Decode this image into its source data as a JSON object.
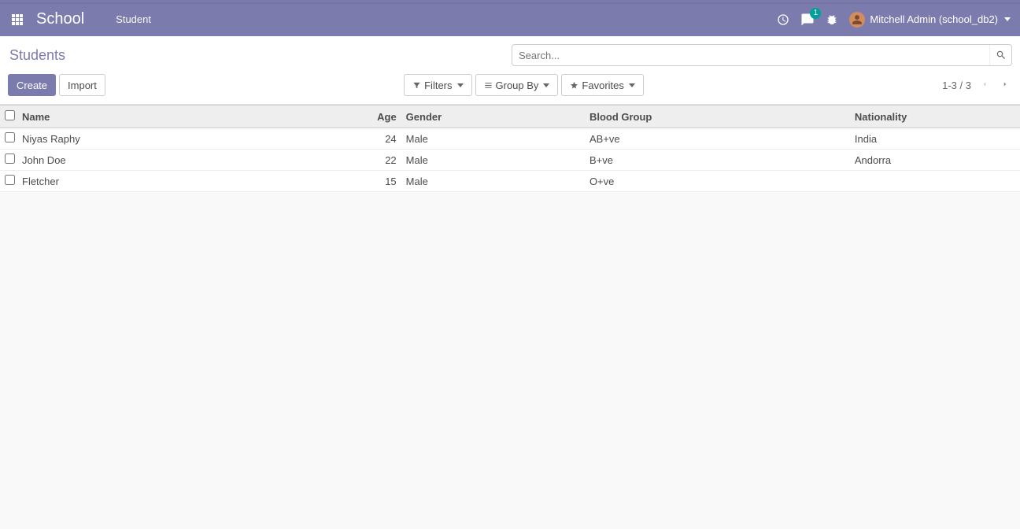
{
  "topbar": {
    "brand": "School",
    "menu_item": "Student",
    "chat_badge": "1",
    "user_label": "Mitchell Admin (school_db2)"
  },
  "breadcrumb": "Students",
  "buttons": {
    "create": "Create",
    "import": "Import"
  },
  "search": {
    "placeholder": "Search..."
  },
  "tools": {
    "filters": "Filters",
    "group_by": "Group By",
    "favorites": "Favorites"
  },
  "pager": {
    "text": "1-3 / 3"
  },
  "table": {
    "headers": {
      "name": "Name",
      "age": "Age",
      "gender": "Gender",
      "blood": "Blood Group",
      "nationality": "Nationality"
    },
    "rows": [
      {
        "name": "Niyas Raphy",
        "age": "24",
        "gender": "Male",
        "blood": "AB+ve",
        "nationality": "India"
      },
      {
        "name": "John Doe",
        "age": "22",
        "gender": "Male",
        "blood": "B+ve",
        "nationality": "Andorra"
      },
      {
        "name": "Fletcher",
        "age": "15",
        "gender": "Male",
        "blood": "O+ve",
        "nationality": ""
      }
    ]
  }
}
